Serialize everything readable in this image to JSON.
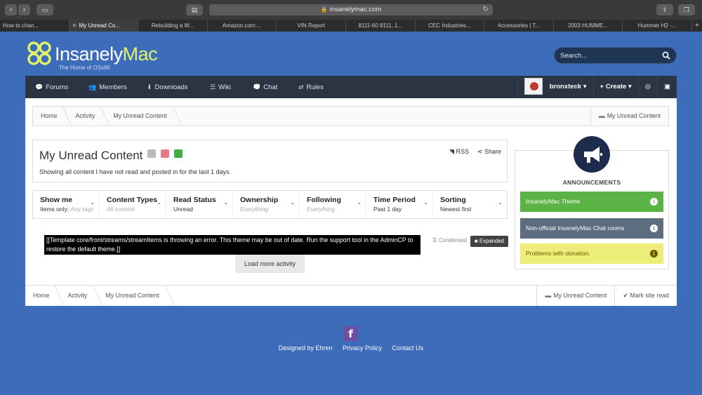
{
  "browser": {
    "url": "insanelymac.com",
    "tabs": [
      "How to chan...",
      "My Unread Co...",
      "Rebuilding a W...",
      "Amazon.com:...",
      "VIN Report",
      "8111-60 8111, 1...",
      "CEC Industries...",
      "Accessories | T...",
      "2003 HUMME...",
      "Hummer H2 -..."
    ]
  },
  "site": {
    "logo_main": "Insanely",
    "logo_accent": "Mac",
    "tagline": "The Home of OSx86",
    "search_placeholder": "Search..."
  },
  "nav": {
    "items": [
      "Forums",
      "Members",
      "Downloads",
      "Wiki",
      "Chat",
      "Rules"
    ],
    "username": "bronxteck",
    "create": "Create"
  },
  "breadcrumb": {
    "items": [
      "Home",
      "Activity",
      "My Unread Content"
    ],
    "right": "My Unread Content",
    "mark_read": "Mark site read"
  },
  "page": {
    "title": "My Unread Content",
    "description": "Showing all content I have not read and posted in for the last 1 days.",
    "rss": "RSS",
    "share": "Share"
  },
  "filters": [
    {
      "title": "Show me",
      "value": "Items only;",
      "hint": "Any tags"
    },
    {
      "title": "Content Types",
      "value": "",
      "hint": "All content"
    },
    {
      "title": "Read Status",
      "value": "Unread",
      "hint": ""
    },
    {
      "title": "Ownership",
      "value": "",
      "hint": "Everything"
    },
    {
      "title": "Following",
      "value": "",
      "hint": "Everything"
    },
    {
      "title": "Time Period",
      "value": "Past 1 day",
      "hint": ""
    },
    {
      "title": "Sorting",
      "value": "Newest first",
      "hint": ""
    }
  ],
  "stream": {
    "error_line1": "[[Template core/front/streams/streamItems is throwing an error. This theme may be out of date. Run the support tool in the AdminCP to",
    "error_line2": "restore the default theme.]]",
    "condensed": "Condensed",
    "expanded": "Expanded",
    "load_more": "Load more activity"
  },
  "announcements": {
    "title": "ANNOUNCEMENTS",
    "items": [
      {
        "label": "InsanelyMac Theme",
        "color": "#5cb345",
        "text_color": "#ffffff"
      },
      {
        "label": "Non-official InsanelyMac Chat rooms",
        "color": "#5d6d80",
        "text_color": "#ffffff"
      },
      {
        "label": "Problems with donation.",
        "color": "#eded7a",
        "text_color": "#6b5a00"
      }
    ]
  },
  "footer": {
    "facebook": "f",
    "links": [
      "Designed by Ehren",
      "Privacy Policy",
      "Contact Us"
    ]
  },
  "colors": {
    "background": "#3d6cbb",
    "navbar": "#2a3442",
    "accent": "#dff26a"
  }
}
